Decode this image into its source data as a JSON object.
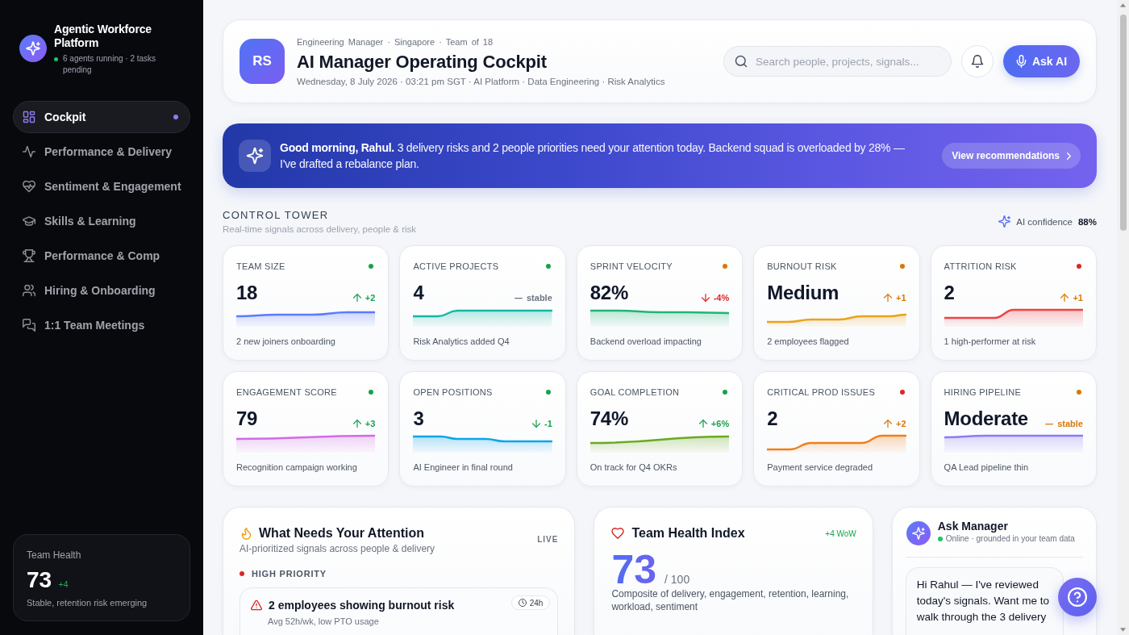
{
  "sidebar": {
    "brand": {
      "title": "Agentic Workforce Platform",
      "status": "6 agents running · 2 tasks pending"
    },
    "nav": [
      {
        "label": "Cockpit",
        "selected": true
      },
      {
        "label": "Performance & Delivery",
        "selected": false
      },
      {
        "label": "Sentiment & Engagement",
        "selected": false
      },
      {
        "label": "Skills & Learning",
        "selected": false
      },
      {
        "label": "Performance & Comp",
        "selected": false
      },
      {
        "label": "Hiring & Onboarding",
        "selected": false
      },
      {
        "label": "1:1 Team Meetings",
        "selected": false
      }
    ],
    "health_card": {
      "title": "Team Health",
      "value": "73",
      "delta": "+4",
      "note": "Stable, retention risk emerging"
    }
  },
  "header": {
    "avatar": "RS",
    "meta": "Engineering Manager · Singapore · Team of 18",
    "title": "AI Manager Operating Cockpit",
    "subtitle": "Wednesday, 8 July 2026 · 03:21 pm SGT · AI Platform · Data Engineering · Risk Analytics",
    "search": {
      "placeholder": "Search people, projects, signals..."
    },
    "ask_button": "Ask AI"
  },
  "banner": {
    "message": "**Good morning, Rahul.** 3 delivery risks and 2 people priorities need your attention today. Backend squad is overloaded by 28% — I've drafted a rebalance plan.",
    "button": "View recommendations"
  },
  "control_tower": {
    "title": "CONTROL TOWER",
    "subtitle": "Real-time signals across delivery, people & risk",
    "confidence_label": "AI confidence",
    "confidence_value": "88%",
    "cards": [
      {
        "label": "TEAM SIZE",
        "color": "#16a34a",
        "value": "18",
        "trend": {
          "kind": "up",
          "text": "+2",
          "color": "#16a34a"
        },
        "sparkline": {
          "kind": "gentle-rise",
          "color": "#5b7cfa"
        },
        "note": "2 new joiners onboarding"
      },
      {
        "label": "ACTIVE PROJECTS",
        "color": "#16a34a",
        "value": "4",
        "trend": {
          "kind": "flat",
          "text": "stable",
          "color": "#6b7280"
        },
        "sparkline": {
          "kind": "early-step-up",
          "color": "#14b8a6"
        },
        "note": "Risk Analytics added Q4"
      },
      {
        "label": "SPRINT VELOCITY",
        "color": "#d97706",
        "value": "82%",
        "trend": {
          "kind": "down",
          "text": "-4%",
          "color": "#dc2626"
        },
        "sparkline": {
          "kind": "flat-decline",
          "color": "#22b573"
        },
        "note": "Backend overload impacting"
      },
      {
        "label": "BURNOUT RISK",
        "color": "#d97706",
        "value": "Medium",
        "trend": {
          "kind": "up",
          "text": "+1",
          "color": "#d97706"
        },
        "sparkline": {
          "kind": "stepped-rise",
          "color": "#e9a31c"
        },
        "note": "2 employees flagged"
      },
      {
        "label": "ATTRITION RISK",
        "color": "#dc2626",
        "value": "2",
        "trend": {
          "kind": "up",
          "text": "+1",
          "color": "#d97706"
        },
        "sparkline": {
          "kind": "mid-step-up",
          "color": "#ef4444"
        },
        "note": "1 high-performer at risk"
      },
      {
        "label": "ENGAGEMENT SCORE",
        "color": "#16a34a",
        "value": "79",
        "trend": {
          "kind": "up",
          "text": "+3",
          "color": "#16a34a"
        },
        "sparkline": {
          "kind": "slight-rise",
          "color": "#d26be6"
        },
        "note": "Recognition campaign working"
      },
      {
        "label": "OPEN POSITIONS",
        "color": "#16a34a",
        "value": "3",
        "trend": {
          "kind": "down",
          "text": "-1",
          "color": "#16a34a"
        },
        "sparkline": {
          "kind": "step-down",
          "color": "#0ea5e9"
        },
        "note": "AI Engineer in final round"
      },
      {
        "label": "GOAL COMPLETION",
        "color": "#16a34a",
        "value": "74%",
        "trend": {
          "kind": "up",
          "text": "+6%",
          "color": "#16a34a"
        },
        "sparkline": {
          "kind": "steady-rise",
          "color": "#6aaa1f"
        },
        "note": "On track for Q4 OKRs"
      },
      {
        "label": "CRITICAL PROD ISSUES",
        "color": "#dc2626",
        "value": "2",
        "trend": {
          "kind": "up",
          "text": "+2",
          "color": "#d97706"
        },
        "sparkline": {
          "kind": "double-step",
          "color": "#f07f1b"
        },
        "note": "Payment service degraded"
      },
      {
        "label": "HIRING PIPELINE",
        "color": "#d97706",
        "value": "Moderate",
        "trend": {
          "kind": "flat",
          "text": "stable",
          "color": "#d97706"
        },
        "sparkline": {
          "kind": "flat",
          "color": "#8b7cf6"
        },
        "note": "QA Lead pipeline thin"
      }
    ]
  },
  "attention": {
    "title": "What Needs Your Attention",
    "badge": "LIVE",
    "subtitle": "AI-prioritized signals across people & delivery",
    "groups": [
      {
        "label": "HIGH PRIORITY",
        "color": "#dc2626",
        "items": [
          {
            "title": "2 employees showing burnout risk",
            "age": "24h",
            "detail": "Avg 52h/wk, low PTO usage"
          }
        ]
      }
    ]
  },
  "health_index": {
    "title": "Team Health Index",
    "change": "+4 WoW",
    "score": "73",
    "scale": "/ 100",
    "description": "Composite of delivery, engagement, retention, learning, workload, sentiment"
  },
  "assistant": {
    "title": "Ask Manager",
    "status": "Online · grounded in your team data",
    "messages": [
      {
        "text": "Hi Rahul — I've reviewed today's signals. Want me to walk through the 3 delivery"
      }
    ]
  }
}
